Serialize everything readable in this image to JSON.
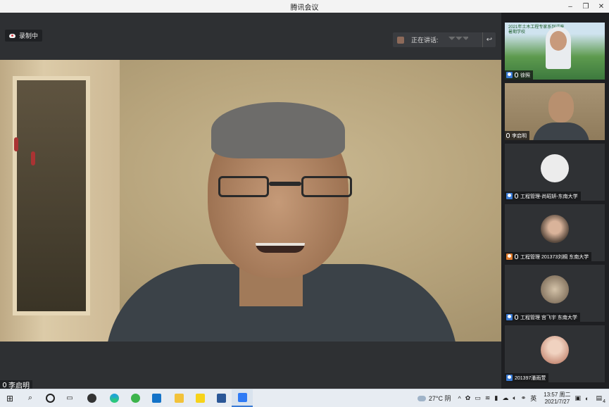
{
  "window": {
    "title": "腾讯会议"
  },
  "main": {
    "recording_label": "录制中",
    "speaking_label": "正在讲话:",
    "active_speaker_name": "李启明"
  },
  "sidebar": {
    "tiles": [
      {
        "name": "徐照",
        "banner": "2021年土木工程专家系列讲座\n暑期学校"
      },
      {
        "name": "李启明"
      },
      {
        "name": "工程管理-尚昭妍-东南大学"
      },
      {
        "name": "工程管理 201373刘桐 东南大学"
      },
      {
        "name": "工程管理 宫飞宇 东南大学"
      },
      {
        "name": "201397潘雨萱"
      }
    ]
  },
  "taskbar": {
    "weather": "27°C 阴",
    "ime": "英",
    "time": "13:57 周二",
    "date": "2021/7/27",
    "notification_count": "4"
  },
  "colors": {
    "accent": "#3a7bd5",
    "taskbar_bg": "#e7ecf2"
  }
}
